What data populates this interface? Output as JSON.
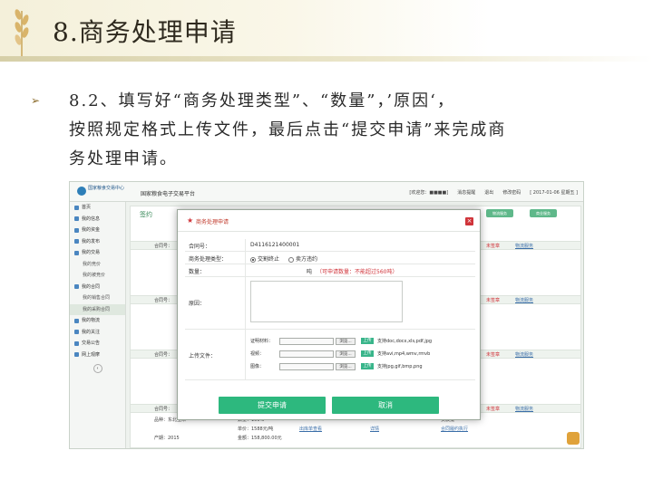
{
  "slide": {
    "title": "8.商务处理申请",
    "bullet_lines": [
      "8.2、填写好“商务处理类型”、“数量”，’原因‘，",
      "按照规定格式上传文件，最后点击“提交申请”来完成商",
      "务处理申请。"
    ]
  },
  "app": {
    "logo_text_1": "国家粮食交易中心",
    "logo_text_2": "",
    "platform_name": "国家粮食电子交易平台",
    "top_bar": [
      "[欢迎您：■■■■]",
      "消息提醒",
      "退出",
      "修改密码",
      "[ 2017-01-06 星期五 ]"
    ],
    "sidebar": [
      {
        "label": "首页",
        "sub": false
      },
      {
        "label": "我的信息",
        "sub": false
      },
      {
        "label": "我的资金",
        "sub": false
      },
      {
        "label": "我的发布",
        "sub": false
      },
      {
        "label": "我的交易",
        "sub": false
      },
      {
        "label": "我的竞价",
        "sub": true
      },
      {
        "label": "我的被竞价",
        "sub": true
      },
      {
        "label": "我的合同",
        "sub": false
      },
      {
        "label": "我的销售合同",
        "sub": true
      },
      {
        "label": "我的采购合同",
        "sub": true
      },
      {
        "label": "我的物流",
        "sub": false
      },
      {
        "label": "我的关注",
        "sub": false
      },
      {
        "label": "交易公告",
        "sub": false
      },
      {
        "label": "网上观摩",
        "sub": false
      }
    ],
    "content_tab": "签约",
    "grid_buttons": [
      "物流服务",
      "商业服务"
    ],
    "bg_rows": [
      {
        "contract": "合同号：",
        "status": "未签章",
        "link": "物流服务"
      },
      {
        "contract": "合同号：",
        "status": "未签章",
        "link": "物流服务"
      },
      {
        "contract": "合同号：",
        "status": "未签章",
        "link": "物流服务"
      },
      {
        "contract": "合同号：",
        "status": "未签章",
        "link": "物流服务"
      }
    ],
    "bottom_row": {
      "variety": "品种：东北玉米",
      "weight": "数量：100%",
      "price": "单价：1588元/吨",
      "amount": "金额：158,800.00元",
      "year": "产期：2015",
      "link1": "出库单查看",
      "link2": "详情",
      "link3": "合同履约执行",
      "status": "货款批"
    }
  },
  "modal": {
    "title": "商务处理申请",
    "close_label": "×",
    "contract_label": "合同号：",
    "contract_value": "D4116121400001",
    "type_label": "商务处理类型：",
    "type_options": [
      "交割终止",
      "卖方违约"
    ],
    "qty_label": "数量：",
    "qty_unit": "吨",
    "qty_hint": "（可申请数量：不能超过560吨）",
    "reason_label": "原因：",
    "upload_label": "上传文件：",
    "uploads": [
      {
        "label": "证明材料：",
        "browse": "浏览...",
        "button": "上传",
        "hint": "支持doc,docx,xls,pdf,jpg"
      },
      {
        "label": "视频：",
        "browse": "浏览...",
        "button": "上传",
        "hint": "支持avi,mp4,wmv,rmvb"
      },
      {
        "label": "图像：",
        "browse": "浏览...",
        "button": "上传",
        "hint": "支持jpg,gif,bmp,png"
      }
    ],
    "submit_label": "提交申请",
    "cancel_label": "取消"
  },
  "colors": {
    "accent_green": "#2db87e",
    "alert_red": "#d0343a"
  }
}
